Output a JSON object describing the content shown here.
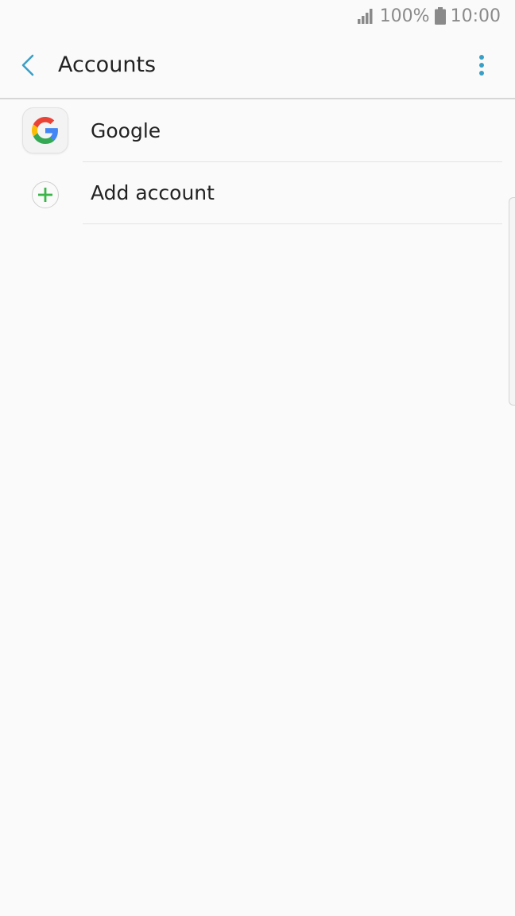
{
  "status_bar": {
    "battery_percent": "100%",
    "time": "10:00",
    "icons": [
      "signal-icon",
      "battery-icon"
    ]
  },
  "app_bar": {
    "title": "Accounts",
    "back_icon": "chevron-left-icon",
    "more_icon": "more-vertical-icon"
  },
  "accounts": [
    {
      "label": "Google",
      "icon": "google-icon"
    },
    {
      "label": "Add account",
      "icon": "plus-icon"
    }
  ],
  "colors": {
    "accent": "#3a9fc7",
    "add_green": "#3bb54a",
    "background": "#fafafa"
  }
}
